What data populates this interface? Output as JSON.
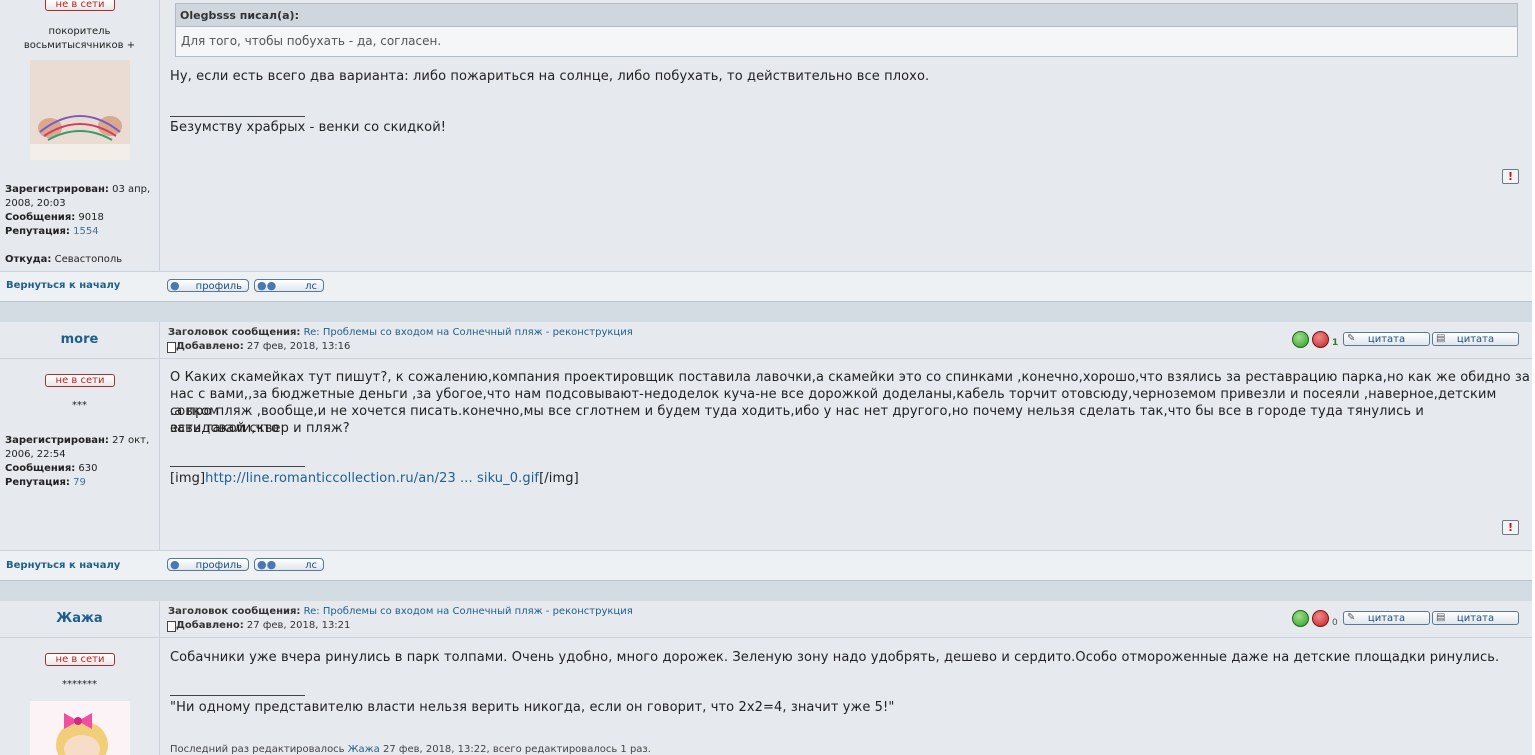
{
  "posts": [
    {
      "status_label": "не в сети",
      "rank": "покоритель восьмитысячников +",
      "registered_label": "Зарегистрирован:",
      "registered_value": " 03 апр, 2008, 20:03",
      "messages_label": "Сообщения:",
      "messages_value": " 9018",
      "reputation_label": "Репутация:",
      "reputation_value": " 1554",
      "from_label": "Откуда:",
      "from_value": " Севастополь",
      "quote_author": "Olegbsss писал(а):",
      "quote_text": "Для того, чтобы побухать - да, согласен.",
      "body": "Ну, если есть всего два варианта: либо пожариться на солнце, либо побухать, то действительно все плохо.",
      "signature": "Безумству храбрых - венки со скидкой!",
      "back_to_top": "Вернуться к началу",
      "profile_btn": "профиль",
      "pm_btn": "лс"
    },
    {
      "author": "more",
      "subject_label": "Заголовок сообщения:",
      "subject": "Re: Проблемы со входом на Солнечный пляж - реконструкция",
      "added_label": "Добавлено:",
      "added": " 27 фев, 2018, 13:16",
      "vote_count": "1",
      "quote_btn_1": "цитата",
      "quote_btn_2": "цитата",
      "status_label": "не в сети",
      "rank": "***",
      "registered_label": "Зарегистрирован:",
      "registered_value": " 27 окт, 2006, 22:54",
      "messages_label": "Сообщения:",
      "messages_value": " 630",
      "reputation_label": "Репутация:",
      "reputation_value": " 79",
      "body_lines": [
        "О Каких скамейках тут пишут?, к сожалению,компания проектировщик поставила лавочки,а скамейки это со спинками ,конечно,хорошо,что взялись за реставрацию парка,но как же обидно за",
        "нас с вами,,за бюджетные деньги ,за убогое,что нам подсовывают-недоделок куча-не все дорожкой доделаны,кабель торчит отовсюду,черноземом привезли и посеяли ,наверное,детским совком",
        ".а про пляж ,вообще,и не хочется писать.конечно,мы все сглотнем и будем туда ходить,ибо у нас нет другого,но почему нельзя сделать так,что бы все в городе туда тянулись и завидовали,что",
        "есть такой сквер и пляж?"
      ],
      "sig_prefix": "[img]",
      "sig_link": "http://line.romanticcollection.ru/an/23 ... siku_0.gif",
      "sig_suffix": "[/img]",
      "back_to_top": "Вернуться к началу",
      "profile_btn": "профиль",
      "pm_btn": "лс"
    },
    {
      "author": "Жажа",
      "subject_label": "Заголовок сообщения:",
      "subject": "Re: Проблемы со входом на Солнечный пляж - реконструкция",
      "added_label": "Добавлено:",
      "added": " 27 фев, 2018, 13:21",
      "vote_count": "0",
      "quote_btn_1": "цитата",
      "quote_btn_2": "цитата",
      "status_label": "не в сети",
      "rank": "*******",
      "body": "Собачники уже вчера ринулись в парк толпами. Очень удобно, много дорожек. Зеленую зону надо удобрять, дешево и сердито.Особо отмороженные даже на детские площадки ринулись.",
      "signature": "\"Ни одному представителю власти нельзя верить никогда, если он говорит, что 2х2=4, значит уже 5!\"",
      "edit_prefix": "Последний раз редактировалось ",
      "edit_user": "Жажа",
      "edit_suffix": " 27 фев, 2018, 13:22, всего редактировалось 1 раз."
    }
  ]
}
